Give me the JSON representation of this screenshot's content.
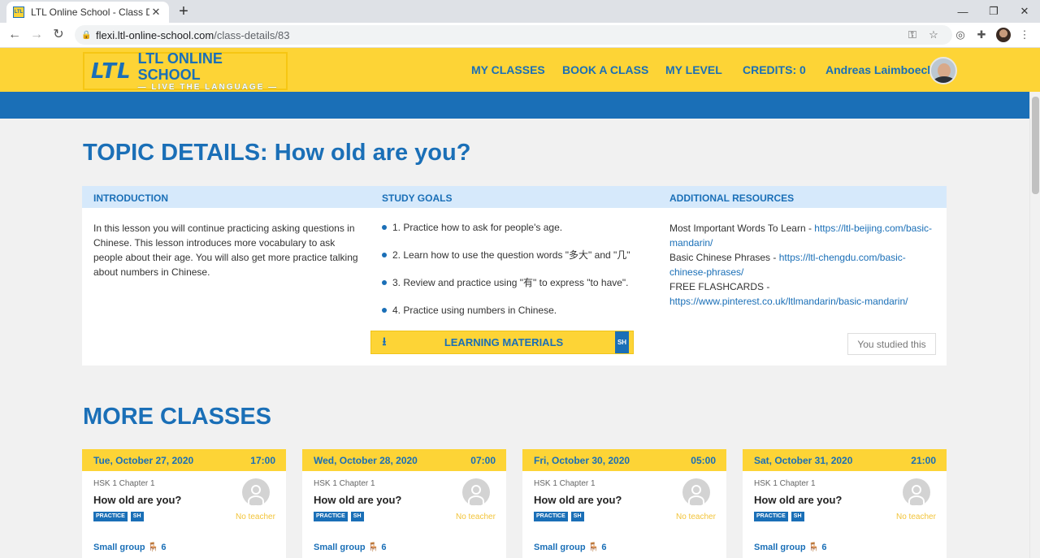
{
  "browser": {
    "tab_title": "LTL Online School - Class Details",
    "favicon_text": "LTL",
    "tab_close": "✕",
    "new_tab": "+",
    "url_host": "flexi.ltl-online-school.com",
    "url_path": "/class-details/83",
    "controls": {
      "minimize": "—",
      "maximize": "❐",
      "close": "✕"
    }
  },
  "header": {
    "logo_mark": "LTL",
    "logo_brand": "LTL ONLINE SCHOOL",
    "logo_tagline": "— LIVE THE LANGUAGE —",
    "nav": {
      "my_classes": "MY CLASSES",
      "book_class": "BOOK A CLASS",
      "my_level": "MY LEVEL",
      "credits": "CREDITS: 0",
      "user": "Andreas Laimboeck"
    }
  },
  "topic": {
    "title": "TOPIC DETAILS: How old are you?",
    "headers": {
      "introduction": "INTRODUCTION",
      "study_goals": "STUDY GOALS",
      "resources": "ADDITIONAL RESOURCES"
    },
    "introduction": "In this lesson you will continue practicing asking questions in Chinese. This lesson introduces more vocabulary to ask people about their age. You will also get more practice talking about numbers in Chinese.",
    "goals": [
      "1. Practice how to ask for people's age.",
      "2. Learn how to use the question words \"多大\" and \"几\"",
      "3. Review and practice using \"有\" to express \"to have\".",
      "4. Practice using numbers in Chinese."
    ],
    "resources": [
      {
        "label": "Most Important Words To Learn - ",
        "link": "https://ltl-beijing.com/basic-mandarin/"
      },
      {
        "label": "Basic Chinese Phrases - ",
        "link": "https://ltl-chengdu.com/basic-chinese-phrases/"
      },
      {
        "label": "FREE FLASHCARDS - ",
        "link": "https://www.pinterest.co.uk/ltlmandarin/basic-mandarin/"
      }
    ],
    "learning_materials": "LEARNING MATERIALS",
    "learning_badge": "SH",
    "studied": "You studied this"
  },
  "more": {
    "title": "MORE CLASSES",
    "classes": [
      {
        "date": "Tue, October 27, 2020",
        "time": "17:00",
        "chapter": "HSK 1 Chapter 1",
        "title": "How old are you?",
        "badge1": "PRACTICE",
        "badge2": "SH",
        "teacher": "No teacher",
        "group": "Small group 🪑 6"
      },
      {
        "date": "Wed, October 28, 2020",
        "time": "07:00",
        "chapter": "HSK 1 Chapter 1",
        "title": "How old are you?",
        "badge1": "PRACTICE",
        "badge2": "SH",
        "teacher": "No teacher",
        "group": "Small group 🪑 6"
      },
      {
        "date": "Fri, October 30, 2020",
        "time": "05:00",
        "chapter": "HSK 1 Chapter 1",
        "title": "How old are you?",
        "badge1": "PRACTICE",
        "badge2": "SH",
        "teacher": "No teacher",
        "group": "Small group 🪑 6"
      },
      {
        "date": "Sat, October 31, 2020",
        "time": "21:00",
        "chapter": "HSK 1 Chapter 1",
        "title": "How old are you?",
        "badge1": "PRACTICE",
        "badge2": "SH",
        "teacher": "No teacher",
        "group": "Small group 🪑 6"
      }
    ]
  },
  "colors": {
    "brand_blue": "#1a6fb7",
    "brand_yellow": "#fdd436",
    "header_tint": "#d6e9fb"
  }
}
